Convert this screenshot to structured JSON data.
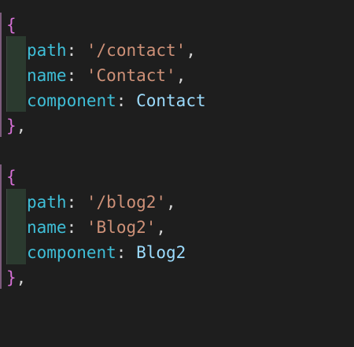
{
  "colors": {
    "background": "#1e1e1e",
    "brace": "#d670d6",
    "key": "#3fbfd8",
    "string": "#ce9178",
    "identifier": "#9cdcfe",
    "punctuation": "#d4d4d4",
    "indent_guide": "#2b3a2f"
  },
  "code": {
    "blocks": [
      {
        "open": "{",
        "props": [
          {
            "key": "path",
            "colon": ":",
            "value": "'/contact'",
            "trail": ","
          },
          {
            "key": "name",
            "colon": ":",
            "value": "'Contact'",
            "trail": ","
          },
          {
            "key": "component",
            "colon": ":",
            "value": "Contact",
            "trail": ""
          }
        ],
        "close": "}",
        "close_trail": ","
      },
      {
        "open": "{",
        "props": [
          {
            "key": "path",
            "colon": ":",
            "value": "'/blog2'",
            "trail": ","
          },
          {
            "key": "name",
            "colon": ":",
            "value": "'Blog2'",
            "trail": ","
          },
          {
            "key": "component",
            "colon": ":",
            "value": "Blog2",
            "trail": ""
          }
        ],
        "close": "}",
        "close_trail": ","
      }
    ]
  }
}
